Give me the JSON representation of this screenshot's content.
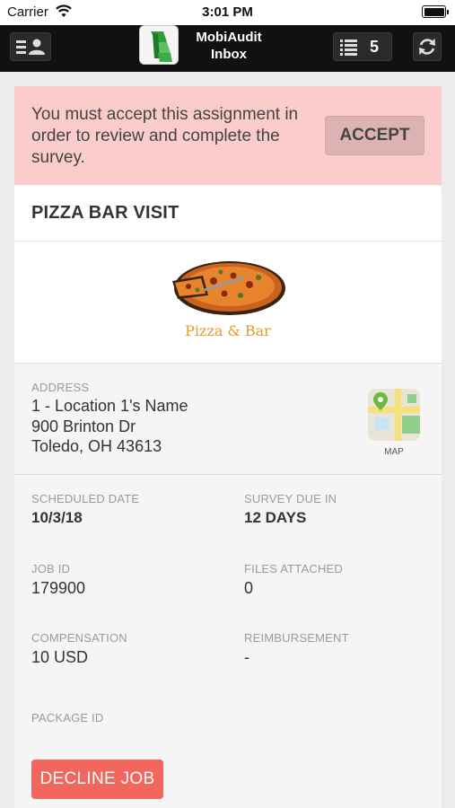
{
  "status_bar": {
    "carrier": "Carrier",
    "time": "3:01 PM"
  },
  "nav": {
    "title_line1": "MobiAudit",
    "title_line2": "Inbox",
    "job_count": "5",
    "icons": [
      "user-list-icon",
      "list-icon",
      "refresh-icon"
    ]
  },
  "banner": {
    "message": "You must accept this assignment in order to review and complete the survey.",
    "accept_label": "ACCEPT",
    "color": "#fbcccc"
  },
  "job": {
    "title": "PIZZA BAR VISIT",
    "logo_text": "Pizza & Bar",
    "address_label": "ADDRESS",
    "address_line1": "1 - Location 1's Name",
    "address_line2": "900 Brinton Dr",
    "address_line3": "Toledo, OH 43613",
    "map_label": "MAP",
    "fields": {
      "scheduled_date": {
        "label": "SCHEDULED DATE",
        "value": "10/3/18"
      },
      "survey_due": {
        "label": "SURVEY DUE IN",
        "value": "12 DAYS"
      },
      "job_id": {
        "label": "JOB ID",
        "value": "179900"
      },
      "files_attached": {
        "label": "FILES ATTACHED",
        "value": "0"
      },
      "compensation": {
        "label": "COMPENSATION",
        "value": "10 USD"
      },
      "reimbursement": {
        "label": "REIMBURSEMENT",
        "value": "-"
      },
      "package_id": {
        "label": "PACKAGE ID",
        "value": ""
      }
    },
    "decline_label": "DECLINE JOB",
    "decline_color": "#f3665e"
  }
}
